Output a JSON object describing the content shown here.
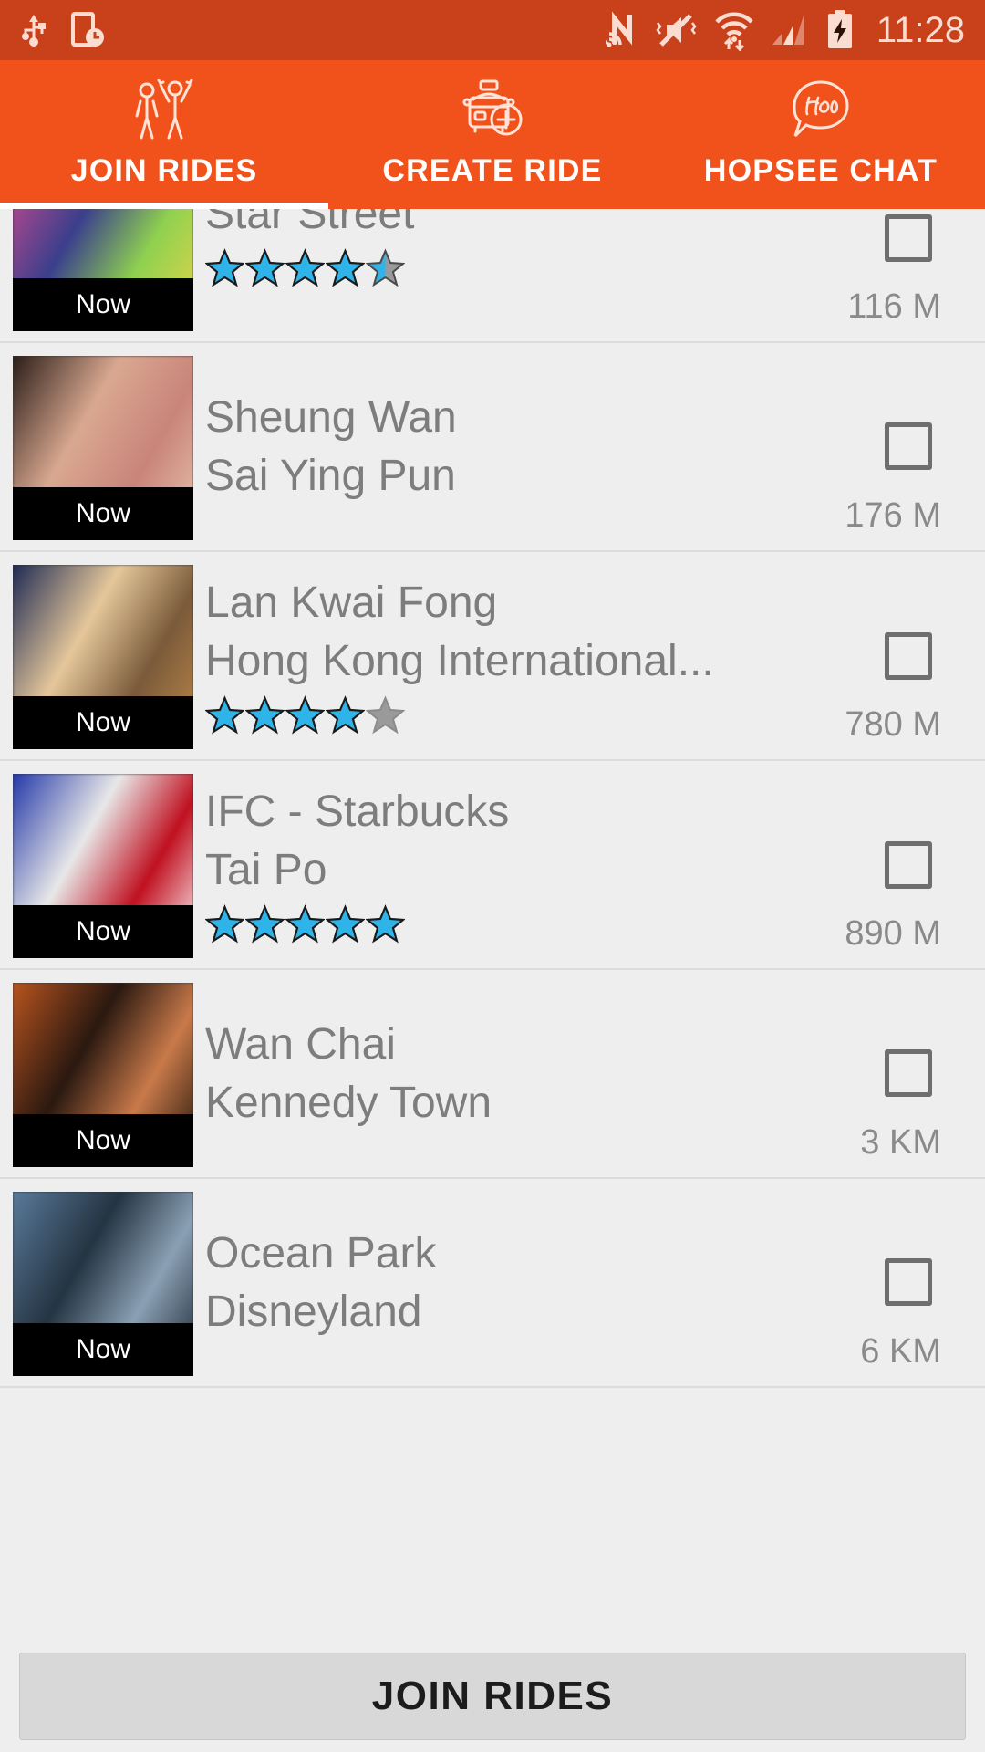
{
  "status_bar": {
    "background": "#c8411b",
    "icon_color": "#fadcd0",
    "time": "11:28",
    "left_icons": [
      "usb-icon",
      "phone-clock-icon"
    ],
    "right_icons": [
      "nfc-icon",
      "mute-vibrate-icon",
      "wifi-data-icon",
      "cellular-signal-icon",
      "battery-charging-icon"
    ]
  },
  "tabs": {
    "background": "#f1511b",
    "active_index": 0,
    "items": [
      {
        "label": "JOIN RIDES",
        "icon": "two-people-icon"
      },
      {
        "label": "CREATE RIDE",
        "icon": "taxi-plus-icon"
      },
      {
        "label": "HOPSEE CHAT",
        "icon": "hop-speech-bubble-icon"
      }
    ]
  },
  "list": {
    "now_label": "Now",
    "star_filled_color": "#2eb4e8",
    "star_empty_color": "#9a9a9a",
    "rows": [
      {
        "origin": "",
        "destination": "Star Street",
        "rating": 4.5,
        "distance": "116 M",
        "now": "Now",
        "thumb_colors": [
          "#d94a8f",
          "#3a3f8c",
          "#8fd14f",
          "#e8d44a"
        ]
      },
      {
        "origin": "Sheung Wan",
        "destination": "Sai Ying Pun",
        "rating": null,
        "distance": "176 M",
        "now": "Now",
        "thumb_colors": [
          "#2a1d18",
          "#d9a890",
          "#c9847a",
          "#e8c5b0"
        ]
      },
      {
        "origin": "Lan Kwai Fong",
        "destination": "Hong Kong International...",
        "rating": 4,
        "distance": "780 M",
        "now": "Now",
        "thumb_colors": [
          "#1e2a54",
          "#e5c79a",
          "#7a5a3a",
          "#c08a4a"
        ]
      },
      {
        "origin": "IFC - Starbucks",
        "destination": "Tai Po",
        "rating": 5,
        "distance": "890 M",
        "now": "Now",
        "thumb_colors": [
          "#2438a8",
          "#e8e8e8",
          "#c01020",
          "#ffffff"
        ]
      },
      {
        "origin": "Wan Chai",
        "destination": "Kennedy Town",
        "rating": null,
        "distance": "3 KM",
        "now": "Now",
        "thumb_colors": [
          "#b8541f",
          "#2a1810",
          "#c97a4a",
          "#1a1008"
        ]
      },
      {
        "origin": "Ocean Park",
        "destination": "Disneyland",
        "rating": null,
        "distance": "6 KM",
        "now": "Now",
        "thumb_colors": [
          "#5a7a9a",
          "#243442",
          "#8aa0b4",
          "#1a2430"
        ]
      }
    ]
  },
  "bottom": {
    "button_label": "JOIN RIDES"
  }
}
